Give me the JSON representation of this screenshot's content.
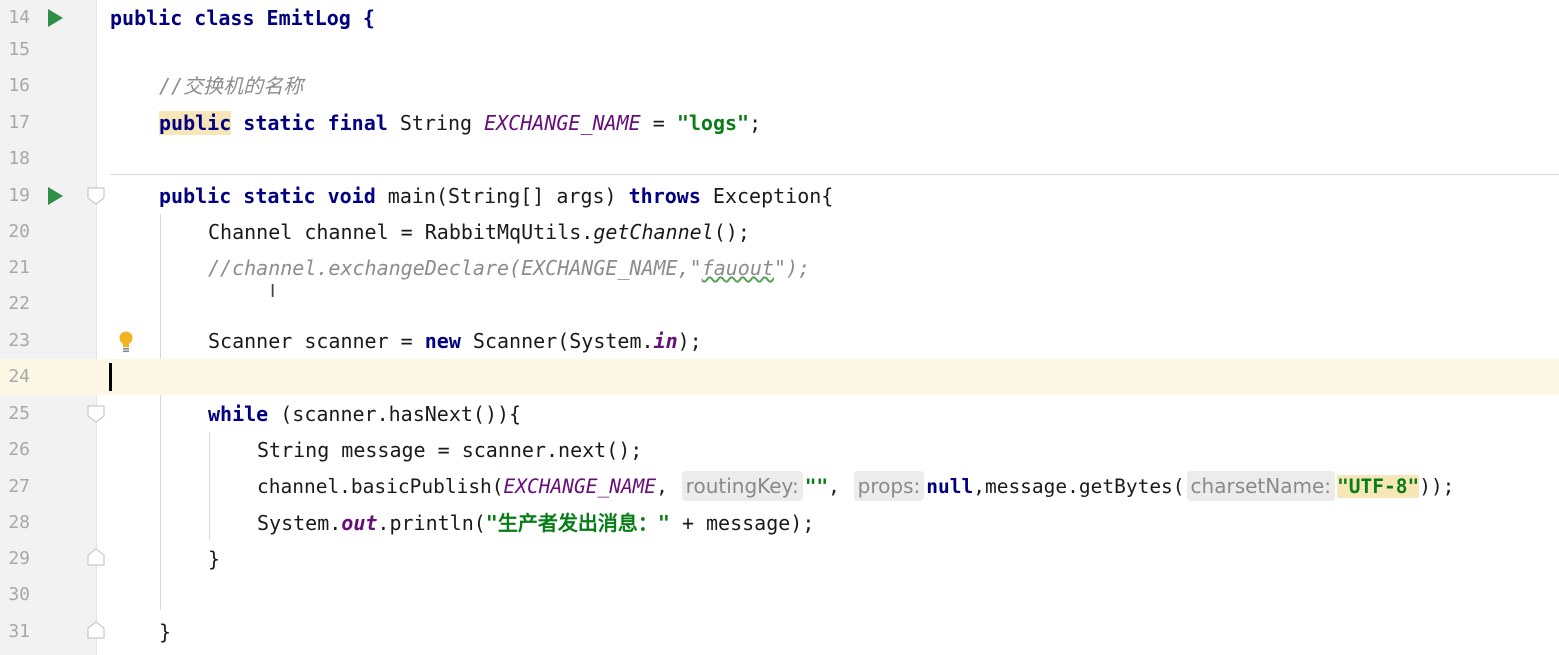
{
  "editor": {
    "lines": [
      {
        "num": "14",
        "t": [
          "public class EmitLog {"
        ]
      },
      {
        "num": "15"
      },
      {
        "num": "16",
        "t": [
          "//交换机的名称"
        ]
      },
      {
        "num": "17",
        "t": [
          "public",
          "static final",
          "String",
          "EXCHANGE_NAME",
          "=",
          "\"logs\"",
          ";"
        ]
      },
      {
        "num": "18"
      },
      {
        "num": "19",
        "t": [
          "public static void",
          "main(String[] args)",
          "throws",
          "Exception{"
        ]
      },
      {
        "num": "20",
        "t": [
          "Channel channel = RabbitMqUtils.",
          "getChannel",
          "();"
        ]
      },
      {
        "num": "21",
        "t": [
          "//channel.exchangeDeclare(EXCHANGE_NAME,\"",
          "fauout",
          "\");"
        ]
      },
      {
        "num": "22"
      },
      {
        "num": "23",
        "t": [
          "Scanner scanner =",
          "new",
          "Scanner(System.",
          "in",
          ");"
        ]
      },
      {
        "num": "24"
      },
      {
        "num": "25",
        "t": [
          "while",
          "(scanner.hasNext()){"
        ]
      },
      {
        "num": "26",
        "t": [
          "String message = scanner.next();"
        ]
      },
      {
        "num": "27",
        "t": [
          "channel.basicPublish(",
          "EXCHANGE_NAME",
          ",",
          "routingKey:",
          "\"\"",
          ",",
          "props:",
          "null",
          ",message.getBytes(",
          "charsetName:",
          "\"UTF-8\"",
          "));"
        ]
      },
      {
        "num": "28",
        "t": [
          "System.",
          "out",
          ".println(",
          "\"生产者发出消息：\"",
          "+ message);"
        ]
      },
      {
        "num": "29",
        "t": [
          "}"
        ]
      },
      {
        "num": "30"
      },
      {
        "num": "31",
        "t": [
          "}"
        ]
      }
    ]
  },
  "icons": {
    "run": "run-icon",
    "fold": "fold-icon",
    "bulb": "lightbulb-icon",
    "cursor": "text-cursor-icon"
  },
  "colors": {
    "keyword": "#000080",
    "constant": "#660e7a",
    "string": "#067d17",
    "comment": "#8c8c8c",
    "current_line": "#fdf8e6",
    "run_icon": "#2f8f46"
  }
}
